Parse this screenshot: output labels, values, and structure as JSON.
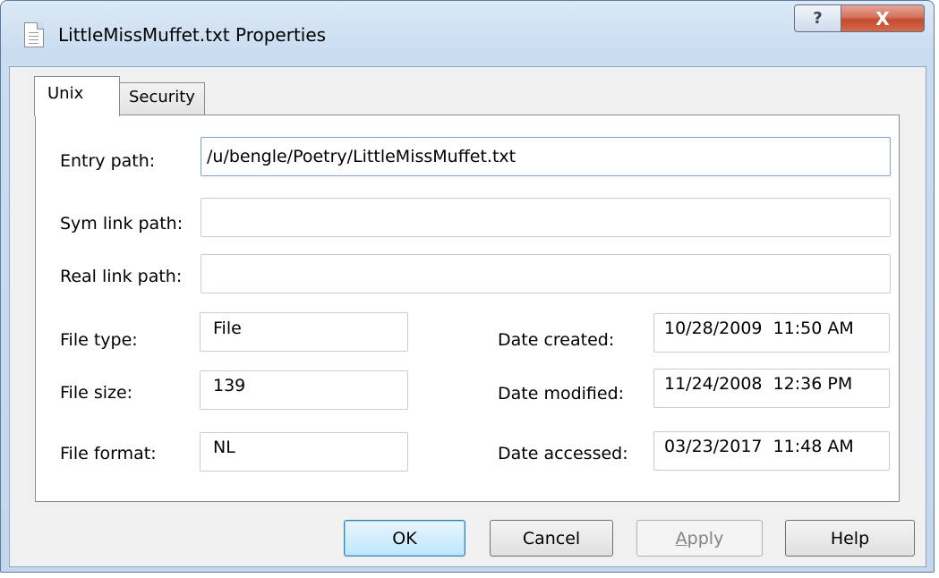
{
  "window": {
    "title": "LittleMissMuffet.txt Properties",
    "help_glyph": "?",
    "close_glyph": "X"
  },
  "tabs": [
    {
      "label": "Unix",
      "selected": true
    },
    {
      "label": "Security",
      "selected": false
    }
  ],
  "fields": {
    "entry_path": {
      "label": "Entry path:",
      "value": "/u/bengle/Poetry/LittleMissMuffet.txt"
    },
    "sym_link_path": {
      "label": "Sym link path:",
      "value": ""
    },
    "real_link_path": {
      "label": "Real link path:",
      "value": ""
    },
    "file_type": {
      "label": "File type:",
      "value": "File"
    },
    "file_size": {
      "label": "File size:",
      "value": "139"
    },
    "file_format": {
      "label": "File format:",
      "value": "NL"
    },
    "date_created": {
      "label": "Date created:",
      "value": "10/28/2009  11:50 AM"
    },
    "date_modified": {
      "label": "Date modified:",
      "value": "11/24/2008  12:36 PM"
    },
    "date_accessed": {
      "label": "Date accessed:",
      "value": "03/23/2017  11:48 AM"
    }
  },
  "buttons": {
    "ok": "OK",
    "cancel": "Cancel",
    "apply_mnemonic": "A",
    "apply_rest": "pply",
    "help": "Help"
  },
  "colors": {
    "title_bar": "#c9dcf0",
    "close_button": "#c24b2f",
    "default_button": "#bee6fd"
  }
}
